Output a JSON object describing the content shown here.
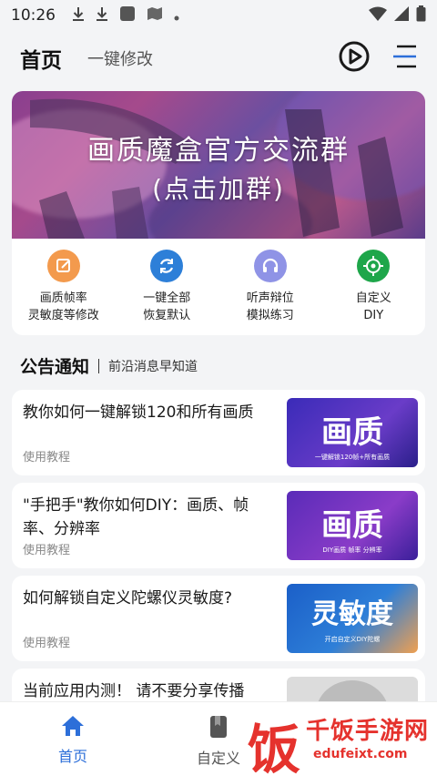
{
  "status_bar": {
    "time": "10:26"
  },
  "header": {
    "title": "首页",
    "subtitle": "一键修改"
  },
  "banner": {
    "line1": "画质魔盒官方交流群",
    "line2": "(点击加群)"
  },
  "quick_actions": [
    {
      "line1": "画质帧率",
      "line2": "灵敏度等修改",
      "icon": "edit-icon",
      "color": "#f39a4d"
    },
    {
      "line1": "一键全部",
      "line2": "恢复默认",
      "icon": "refresh-icon",
      "color": "#2d7fd8"
    },
    {
      "line1": "听声辩位",
      "line2": "模拟练习",
      "icon": "headphones-icon",
      "color": "#8f93e6"
    },
    {
      "line1": "自定义",
      "line2": "DIY",
      "icon": "crosshair-icon",
      "color": "#1ea64a"
    }
  ],
  "notice": {
    "heading": "公告通知",
    "subheading": "前沿消息早知道"
  },
  "articles": [
    {
      "title": "教你如何一键解锁120和所有画质",
      "tag": "使用教程",
      "thumb_big": "画质",
      "thumb_small": "一键解锁120帧+所有画质"
    },
    {
      "title": "\"手把手\"教你如何DIY：画质、帧率、分辨率",
      "tag": "使用教程",
      "thumb_big": "画质",
      "thumb_small": "DIY画质 帧率 分辨率"
    },
    {
      "title": "如何解锁自定义陀螺仪灵敏度?",
      "tag": "使用教程",
      "thumb_big": "灵敏度",
      "thumb_small": "开启自定义DIY陀螺"
    },
    {
      "title": "当前应用内测！ 请不要分享传播",
      "tag": "",
      "thumb_big": "",
      "thumb_small": ""
    }
  ],
  "bottom_nav": [
    {
      "label": "首页",
      "icon": "home-icon",
      "active": true
    },
    {
      "label": "自定义",
      "icon": "bookmark-icon",
      "active": false
    }
  ],
  "watermark": {
    "char": "饭",
    "brand": "千饭手游网",
    "url": "edufeixt.com"
  },
  "colors": {
    "accent": "#2d6fd9",
    "background": "#f3f4f6"
  }
}
